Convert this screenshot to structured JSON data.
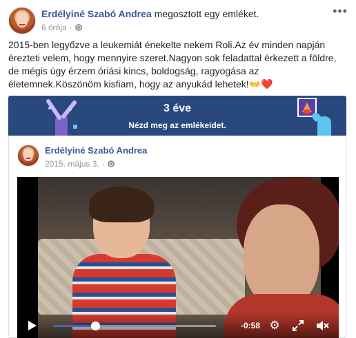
{
  "post": {
    "author": "Erdélyiné Szabó Andrea",
    "action": "megosztott egy emléket.",
    "time": "6 órája",
    "more_icon": "more-dots-icon",
    "text_main": "2015-ben legyőzve a leukemiát énekelte nekem Roli.Az év minden napján érezteti velem, hogy mennyire szeret.Nagyon sok feladattal érkezett a földre, de mégis úgy érzem óriási kincs, boldogság, ragyogása az életemnek.Köszönöm kisfiam, hogy az anyukád lehetek!",
    "emoji_hands": "👐",
    "emoji_heart": "❤️"
  },
  "memory_banner": {
    "years": "3 éve",
    "cta": "Nézd meg az emlékeidet.",
    "background_color": "#29487d"
  },
  "shared_post": {
    "author": "Erdélyiné Szabó Andrea",
    "date": "2015. május 3."
  },
  "video": {
    "time_remaining": "-0:58",
    "progress_fraction": 0.26,
    "accent_color": "#4267b2",
    "icons": [
      "play-icon",
      "settings-gear-icon",
      "fullscreen-icon",
      "volume-muted-icon"
    ]
  }
}
